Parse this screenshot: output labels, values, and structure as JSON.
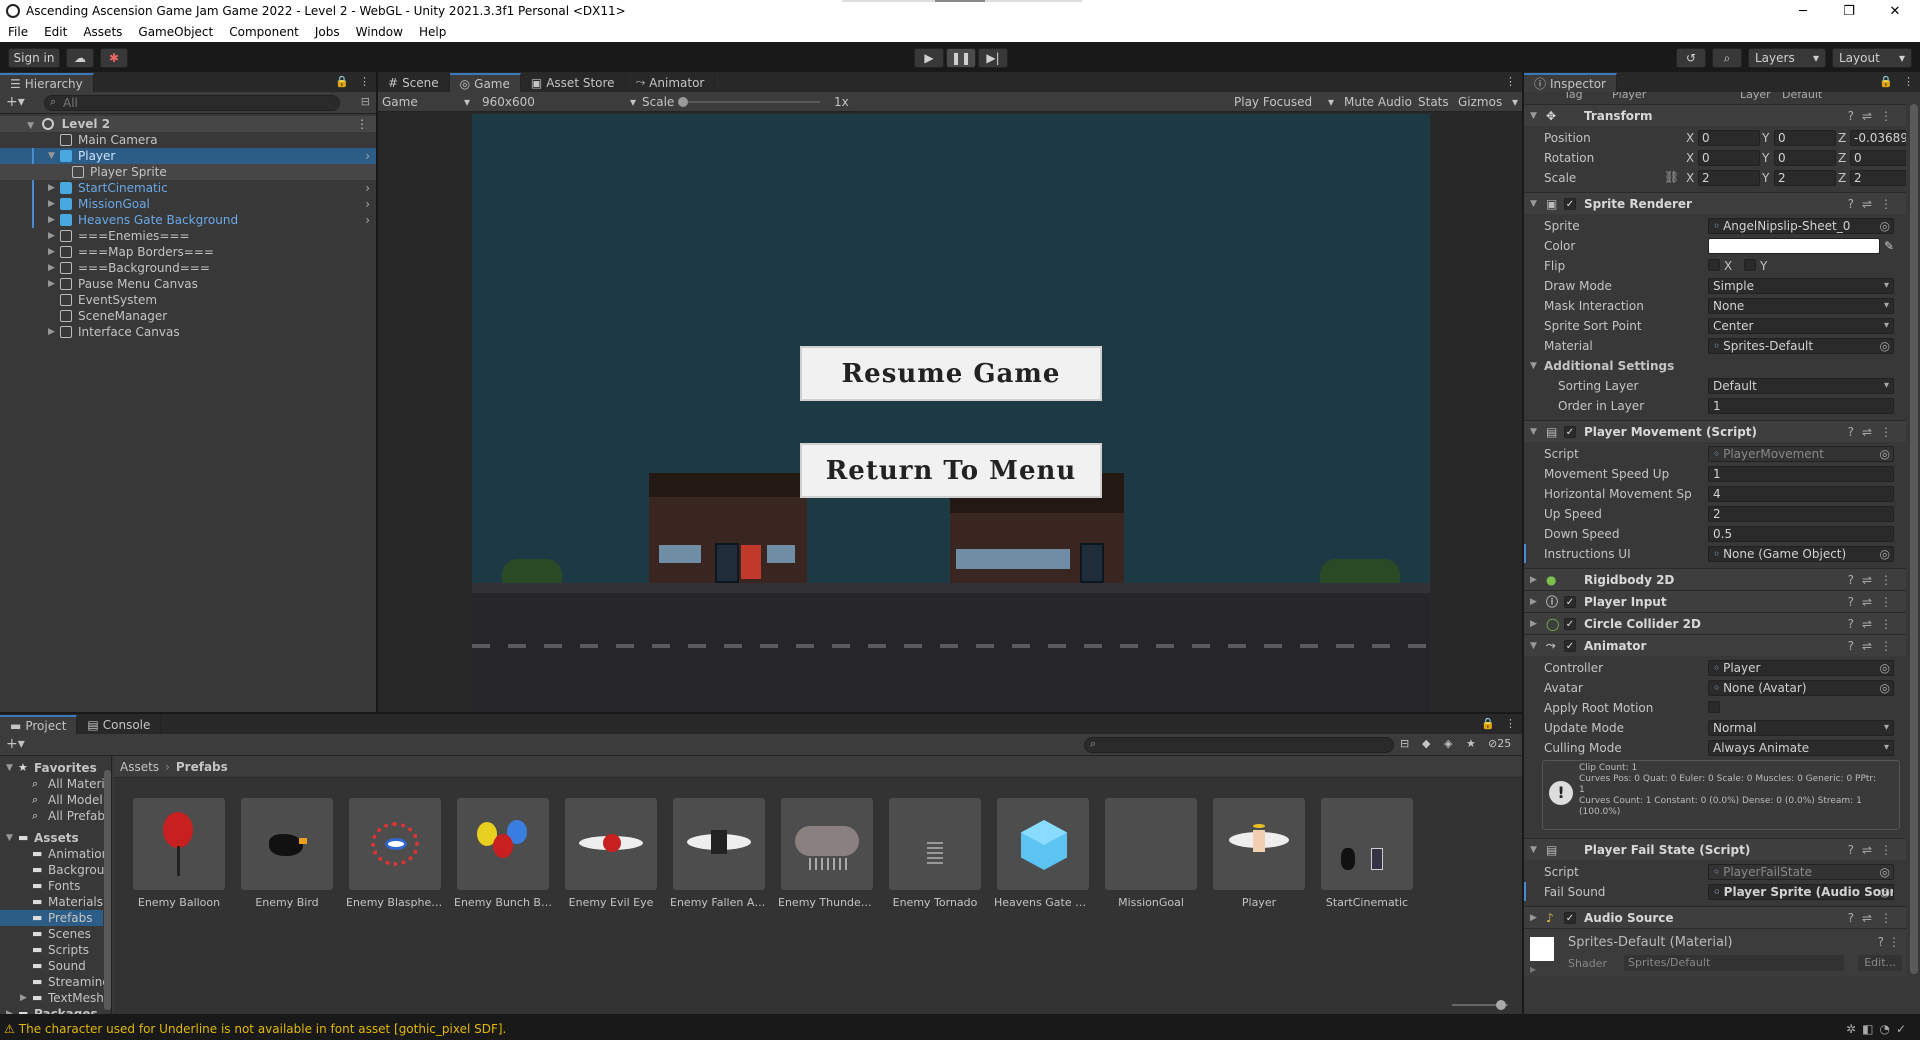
{
  "window": {
    "title": "Ascending Ascension Game Jam Game 2022 - Level 2 - WebGL - Unity 2021.3.3f1 Personal <DX11>",
    "minimize": "─",
    "maximize": "❐",
    "close": "✕"
  },
  "menu": [
    "File",
    "Edit",
    "Assets",
    "GameObject",
    "Component",
    "Jobs",
    "Window",
    "Help"
  ],
  "toolbar": {
    "sign_in": "Sign in",
    "layers": "Layers",
    "layout": "Layout"
  },
  "hierarchy": {
    "tab": "Hierarchy",
    "search_placeholder": "All",
    "scene": "Level 2",
    "items": [
      {
        "label": "Main Camera",
        "depth": 1,
        "prefab": false,
        "arrow": false
      },
      {
        "label": "Player",
        "depth": 1,
        "prefab": true,
        "arrow": true,
        "expanded": true,
        "selected": true
      },
      {
        "label": "Player Sprite",
        "depth": 2,
        "prefab": false,
        "arrow": false,
        "highlight": true
      },
      {
        "label": "StartCinematic",
        "depth": 1,
        "prefab": true,
        "arrow": true
      },
      {
        "label": "MissionGoal",
        "depth": 1,
        "prefab": true,
        "arrow": true
      },
      {
        "label": "Heavens Gate Background",
        "depth": 1,
        "prefab": true,
        "arrow": true
      },
      {
        "label": "===Enemies===",
        "depth": 1,
        "prefab": false,
        "arrow": true
      },
      {
        "label": "===Map Borders===",
        "depth": 1,
        "prefab": false,
        "arrow": true
      },
      {
        "label": "===Background===",
        "depth": 1,
        "prefab": false,
        "arrow": true
      },
      {
        "label": "Pause Menu Canvas",
        "depth": 1,
        "prefab": false,
        "arrow": true
      },
      {
        "label": "EventSystem",
        "depth": 1,
        "prefab": false,
        "arrow": false
      },
      {
        "label": "SceneManager",
        "depth": 1,
        "prefab": false,
        "arrow": false
      },
      {
        "label": "Interface Canvas",
        "depth": 1,
        "prefab": false,
        "arrow": true
      }
    ]
  },
  "center_tabs": {
    "scene": "Scene",
    "game": "Game",
    "asset_store": "Asset Store",
    "animator": "Animator"
  },
  "game_toolbar": {
    "display": "Game",
    "resolution": "960x600",
    "scale_label": "Scale",
    "scale_value": "1x",
    "play_focused": "Play Focused",
    "mute": "Mute Audio",
    "stats": "Stats",
    "gizmos": "Gizmos"
  },
  "game_view": {
    "resume_button": "Resume Game",
    "return_button": "Return To Menu"
  },
  "inspector": {
    "tab": "Inspector",
    "tag_label": "Tag",
    "tag_value": "Player",
    "layer_label": "Layer",
    "layer_value": "Default",
    "transform": {
      "title": "Transform",
      "position_label": "Position",
      "position": {
        "x": "0",
        "y": "0",
        "z": "-0.03689"
      },
      "rotation_label": "Rotation",
      "rotation": {
        "x": "0",
        "y": "0",
        "z": "0"
      },
      "scale_label": "Scale",
      "scale": {
        "x": "2",
        "y": "2",
        "z": "2"
      }
    },
    "sprite_renderer": {
      "title": "Sprite Renderer",
      "rows": [
        {
          "label": "Sprite",
          "value": "AngelNipslip-Sheet_0"
        },
        {
          "label": "Color",
          "value": ""
        },
        {
          "label": "Flip",
          "value": ""
        },
        {
          "label": "Draw Mode",
          "value": "Simple"
        },
        {
          "label": "Mask Interaction",
          "value": "None"
        },
        {
          "label": "Sprite Sort Point",
          "value": "Center"
        },
        {
          "label": "Material",
          "value": "Sprites-Default"
        }
      ],
      "flip_x": "X",
      "flip_y": "Y",
      "additional": "Additional Settings",
      "sorting_layer_label": "Sorting Layer",
      "sorting_layer": "Default",
      "order_label": "Order in Layer",
      "order": "1"
    },
    "player_movement": {
      "title": "Player Movement (Script)",
      "rows": [
        {
          "label": "Script",
          "value": "PlayerMovement"
        },
        {
          "label": "Movement Speed Up",
          "value": "1"
        },
        {
          "label": "Horizontal Movement Sp",
          "value": "4"
        },
        {
          "label": "Up Speed",
          "value": "2"
        },
        {
          "label": "Down Speed",
          "value": "0.5"
        },
        {
          "label": "Instructions UI",
          "value": "None (Game Object)"
        }
      ]
    },
    "rigidbody": "Rigidbody 2D",
    "player_input": "Player Input",
    "circle_collider": "Circle Collider 2D",
    "animator": {
      "title": "Animator",
      "rows": [
        {
          "label": "Controller",
          "value": "Player"
        },
        {
          "label": "Avatar",
          "value": "None (Avatar)"
        },
        {
          "label": "Apply Root Motion",
          "value": ""
        },
        {
          "label": "Update Mode",
          "value": "Normal"
        },
        {
          "label": "Culling Mode",
          "value": "Always Animate"
        }
      ],
      "info_lines": [
        "Clip Count: 1",
        "Curves Pos: 0 Quat: 0 Euler: 0 Scale: 0 Muscles: 0 Generic: 0 PPtr:",
        "1",
        "Curves Count: 1 Constant: 0 (0.0%) Dense: 0 (0.0%) Stream: 1",
        "(100.0%)"
      ]
    },
    "fail_state": {
      "title": "Player Fail State (Script)",
      "script_label": "Script",
      "script_value": "PlayerFailState",
      "sound_label": "Fail Sound",
      "sound_value": "Player Sprite (Audio Source)"
    },
    "audio_source": "Audio Source",
    "material": {
      "name": "Sprites-Default (Material)",
      "shader_label": "Shader",
      "shader_value": "Sprites/Default",
      "edit": "Edit..."
    }
  },
  "project": {
    "tabs": {
      "project": "Project",
      "console": "Console"
    },
    "count": "25",
    "breadcrumb": [
      "Assets",
      "Prefabs"
    ],
    "favorites": {
      "label": "Favorites",
      "items": [
        "All Materi",
        "All Model",
        "All Prefab"
      ]
    },
    "assets": {
      "label": "Assets",
      "items": [
        "Animation",
        "Backgrou",
        "Fonts",
        "Materials",
        "Prefabs",
        "Scenes",
        "Scripts",
        "Sound",
        "Streaming",
        "TextMesh"
      ]
    },
    "packages": "Packages",
    "grid": [
      {
        "name": "Enemy Balloon",
        "icon": "balloon"
      },
      {
        "name": "Enemy Bird",
        "icon": "bird"
      },
      {
        "name": "Enemy Blasphemy",
        "icon": "eye"
      },
      {
        "name": "Enemy Bunch Bal...",
        "icon": "balloons"
      },
      {
        "name": "Enemy Evil Eye",
        "icon": "wing-eye"
      },
      {
        "name": "Enemy Fallen An...",
        "icon": "fallen"
      },
      {
        "name": "Enemy Thunder C...",
        "icon": "cloud"
      },
      {
        "name": "Enemy Tornado",
        "icon": "tornado"
      },
      {
        "name": "Heavens Gate Ba...",
        "icon": "cube"
      },
      {
        "name": "MissionGoal",
        "icon": "empty"
      },
      {
        "name": "Player",
        "icon": "angel"
      },
      {
        "name": "StartCinematic",
        "icon": "cinematic"
      }
    ]
  },
  "status": {
    "message": "The character used for Underline is not available in font asset [gothic_pixel SDF]."
  },
  "colors": {
    "accent": "#3a79bb",
    "prefab_blue": "#6aa9e8",
    "warning": "#f0c000",
    "game_bg": "#1d3a44"
  }
}
